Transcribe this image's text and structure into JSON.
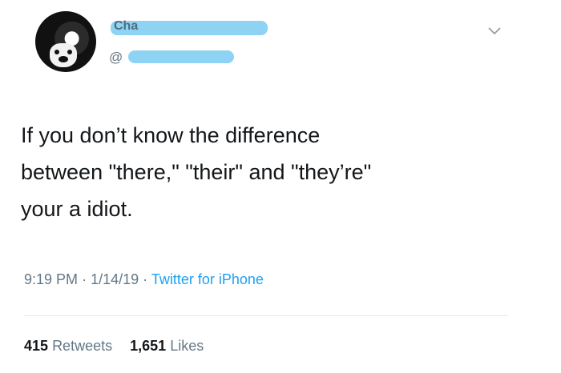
{
  "user": {
    "name_fragment": "Cha",
    "handle_prefix": "@"
  },
  "tweet": {
    "lines": [
      "If you don’t know the difference",
      "between \"there,\" \"their\" and \"they’re\"",
      "your a idiot."
    ],
    "time": "9:19 PM",
    "date": "1/14/19",
    "source": "Twitter for iPhone",
    "separator": "·"
  },
  "stats": {
    "retweets_count": "415",
    "retweets_label": "Retweets",
    "likes_count": "1,651",
    "likes_label": "Likes"
  },
  "colors": {
    "redaction": "#8fd3f4",
    "link": "#1da1f2",
    "muted": "#657786"
  },
  "icons": {
    "menu": "chevron-down-icon"
  }
}
